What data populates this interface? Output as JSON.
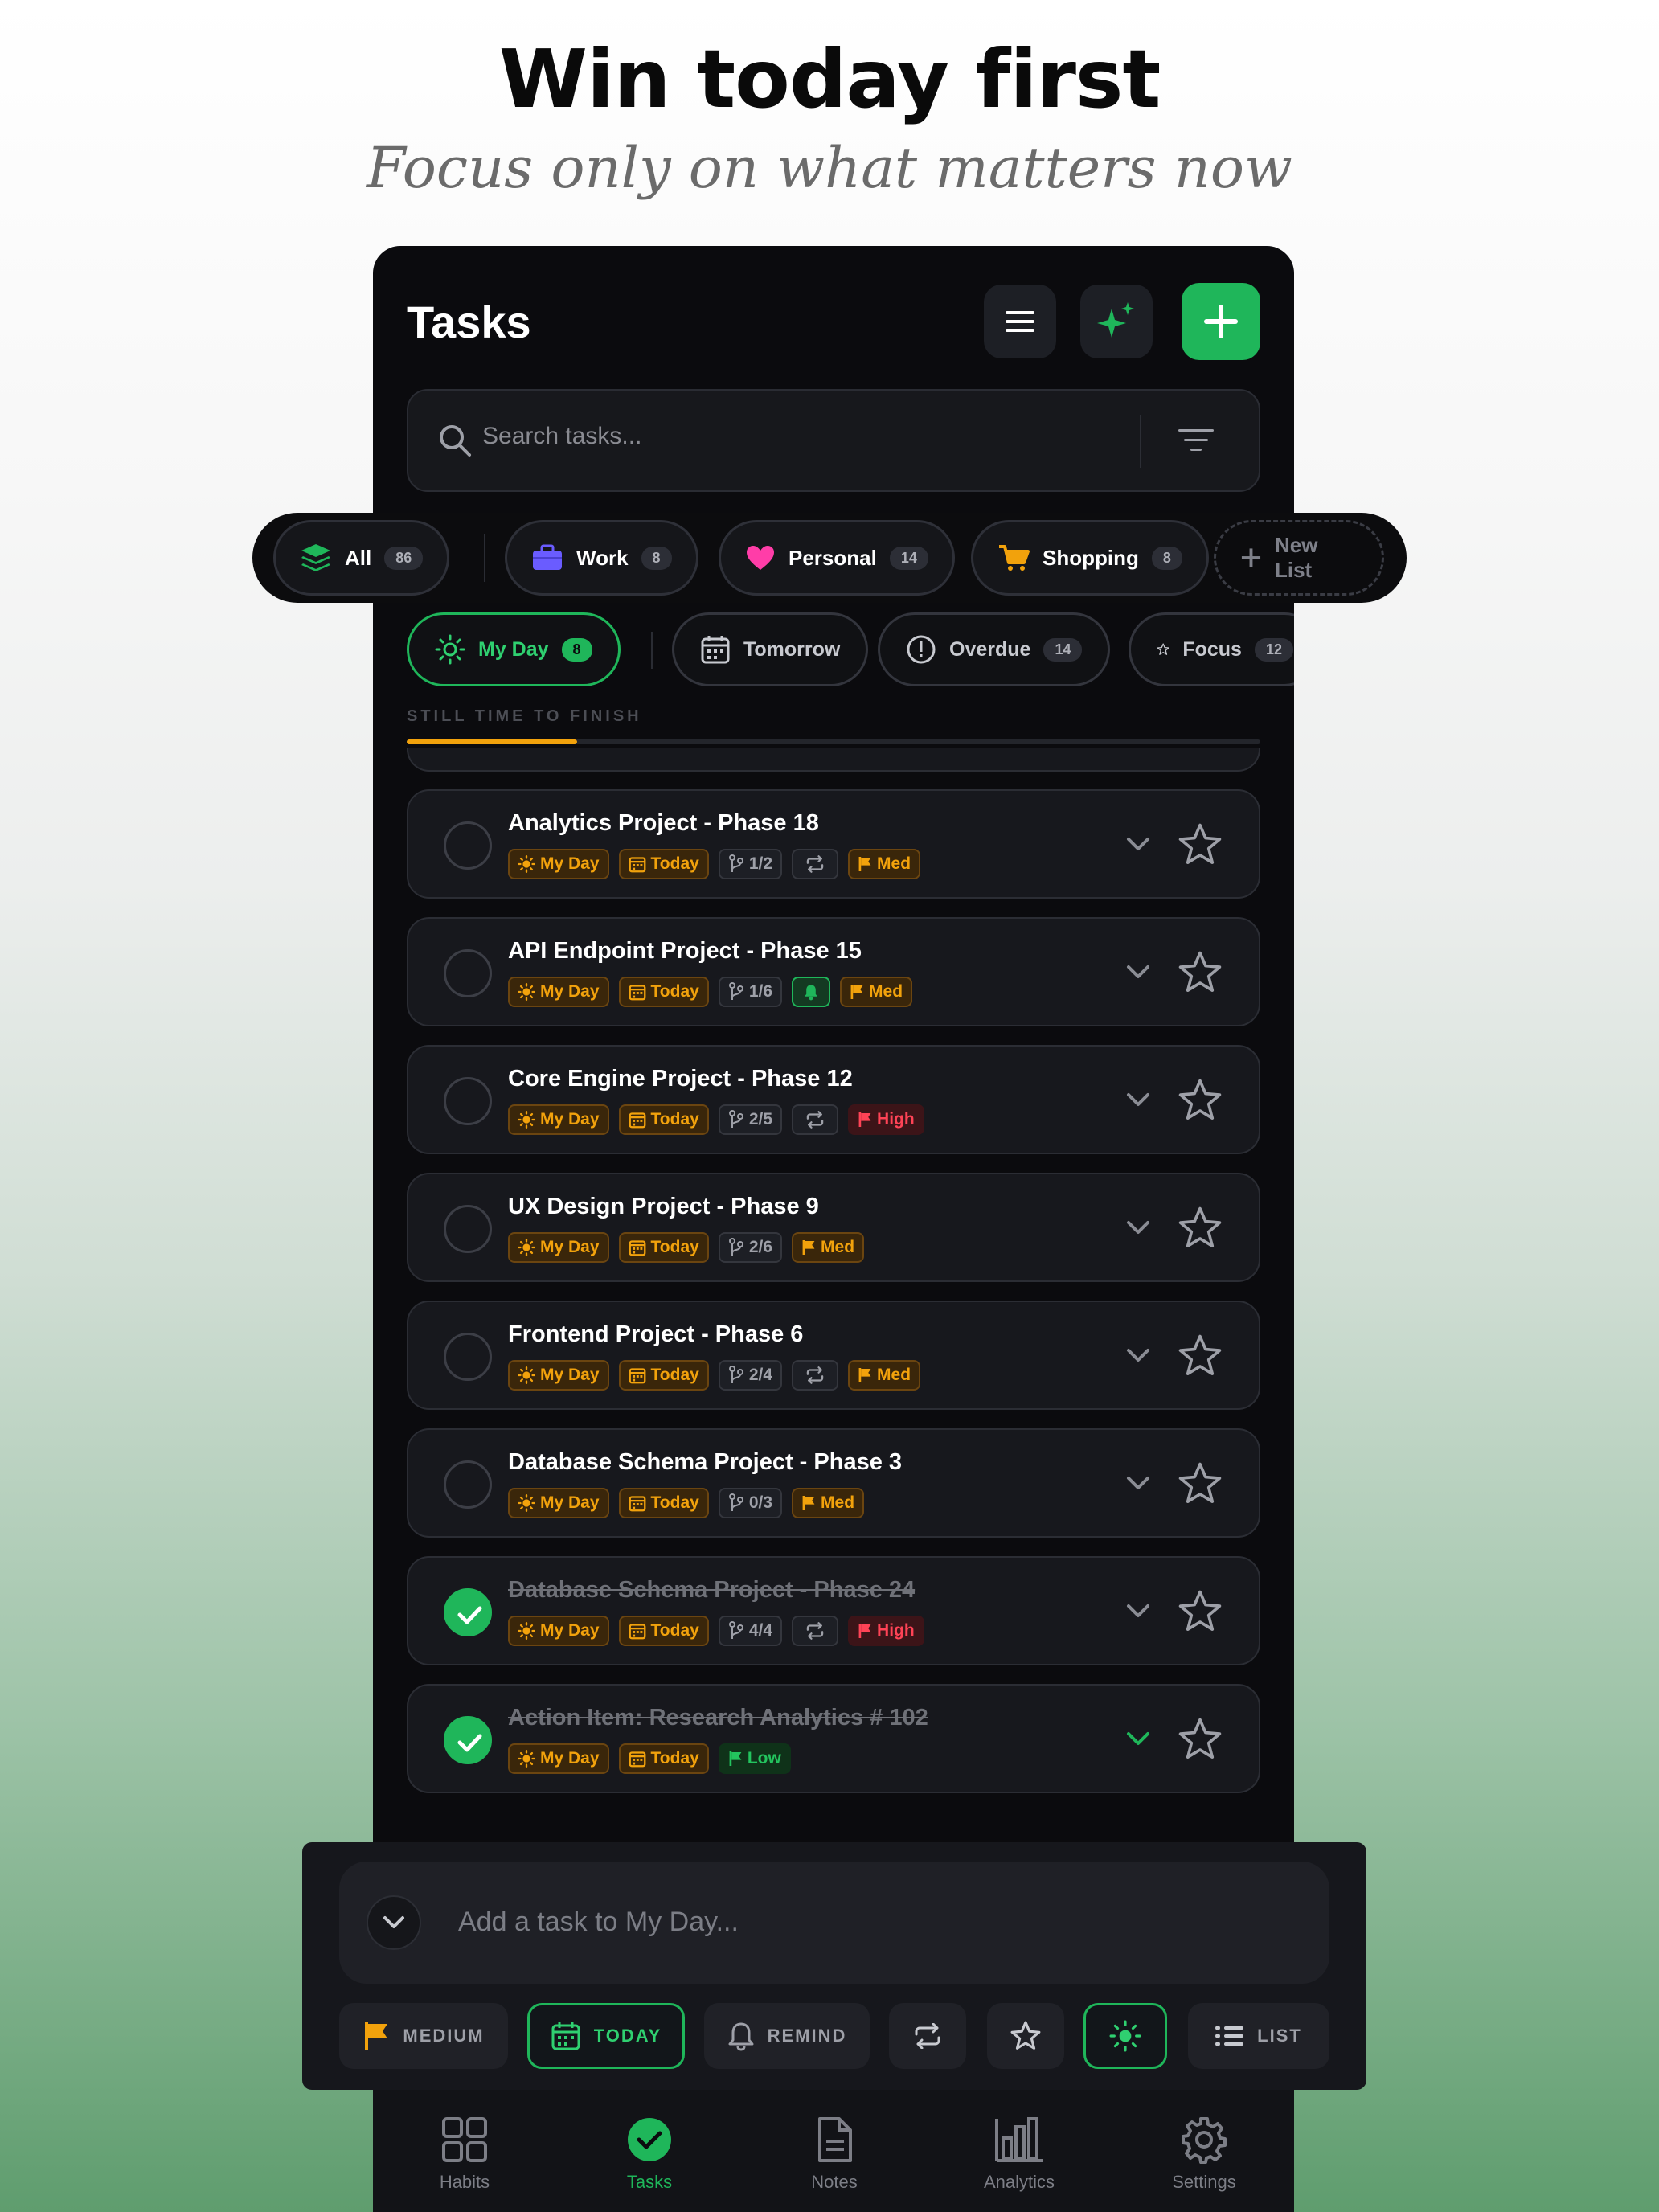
{
  "promo": {
    "headline": "Win today first",
    "subline": "Focus only on what matters now"
  },
  "header": {
    "title": "Tasks",
    "menu_icon": "menu-icon",
    "ai_icon": "sparkles-icon",
    "add_icon": "plus-icon"
  },
  "search": {
    "placeholder": "Search tasks..."
  },
  "lists": [
    {
      "label": "All",
      "count": "86",
      "icon": "layers-icon"
    },
    {
      "label": "Work",
      "count": "8",
      "icon": "briefcase-icon"
    },
    {
      "label": "Personal",
      "count": "14",
      "icon": "heart-icon"
    },
    {
      "label": "Shopping",
      "count": "8",
      "icon": "cart-icon"
    },
    {
      "label": "New List",
      "icon": "plus-icon"
    }
  ],
  "filters": [
    {
      "label": "My Day",
      "count": "8",
      "active": true
    },
    {
      "label": "Tomorrow"
    },
    {
      "label": "Overdue",
      "count": "14"
    },
    {
      "label": "Focus",
      "count": "12"
    }
  ],
  "section_label": "STILL TIME TO FINISH",
  "progress": 0.2,
  "tasks": [
    {
      "title": "Analytics Project - Phase 18",
      "done": false,
      "myday": "My Day",
      "due": "Today",
      "subtasks": "1/2",
      "repeat": true,
      "priority": "Med"
    },
    {
      "title": "API Endpoint Project - Phase 15",
      "done": false,
      "myday": "My Day",
      "due": "Today",
      "subtasks": "1/6",
      "bell": true,
      "priority": "Med"
    },
    {
      "title": "Core Engine Project - Phase 12",
      "done": false,
      "myday": "My Day",
      "due": "Today",
      "subtasks": "2/5",
      "repeat": true,
      "priority": "High"
    },
    {
      "title": "UX Design Project - Phase 9",
      "done": false,
      "myday": "My Day",
      "due": "Today",
      "subtasks": "2/6",
      "priority": "Med"
    },
    {
      "title": "Frontend Project - Phase 6",
      "done": false,
      "myday": "My Day",
      "due": "Today",
      "subtasks": "2/4",
      "repeat": true,
      "priority": "Med"
    },
    {
      "title": "Database Schema Project - Phase 3",
      "done": false,
      "myday": "My Day",
      "due": "Today",
      "subtasks": "0/3",
      "priority": "Med"
    },
    {
      "title": "Database Schema Project - Phase 24",
      "done": true,
      "myday": "My Day",
      "due": "Today",
      "subtasks": "4/4",
      "repeat": true,
      "priority": "High"
    },
    {
      "title": "Action Item: Research Analytics # 102",
      "done": true,
      "myday": "My Day",
      "due": "Today",
      "priority": "Low"
    }
  ],
  "composer": {
    "placeholder": "Add a task to My Day...",
    "priority_label": "MEDIUM",
    "date_label": "TODAY",
    "remind_label": "REMIND",
    "list_label": "LIST"
  },
  "nav": [
    {
      "label": "Habits",
      "icon": "grid-icon"
    },
    {
      "label": "Tasks",
      "icon": "check-circle-icon",
      "active": true
    },
    {
      "label": "Notes",
      "icon": "document-icon"
    },
    {
      "label": "Analytics",
      "icon": "bar-chart-icon"
    },
    {
      "label": "Settings",
      "icon": "gear-icon"
    }
  ],
  "colors": {
    "accent": "#1fb65a",
    "warning": "#f2a20c",
    "danger": "#ff4356",
    "background": "#0b0b0e"
  }
}
